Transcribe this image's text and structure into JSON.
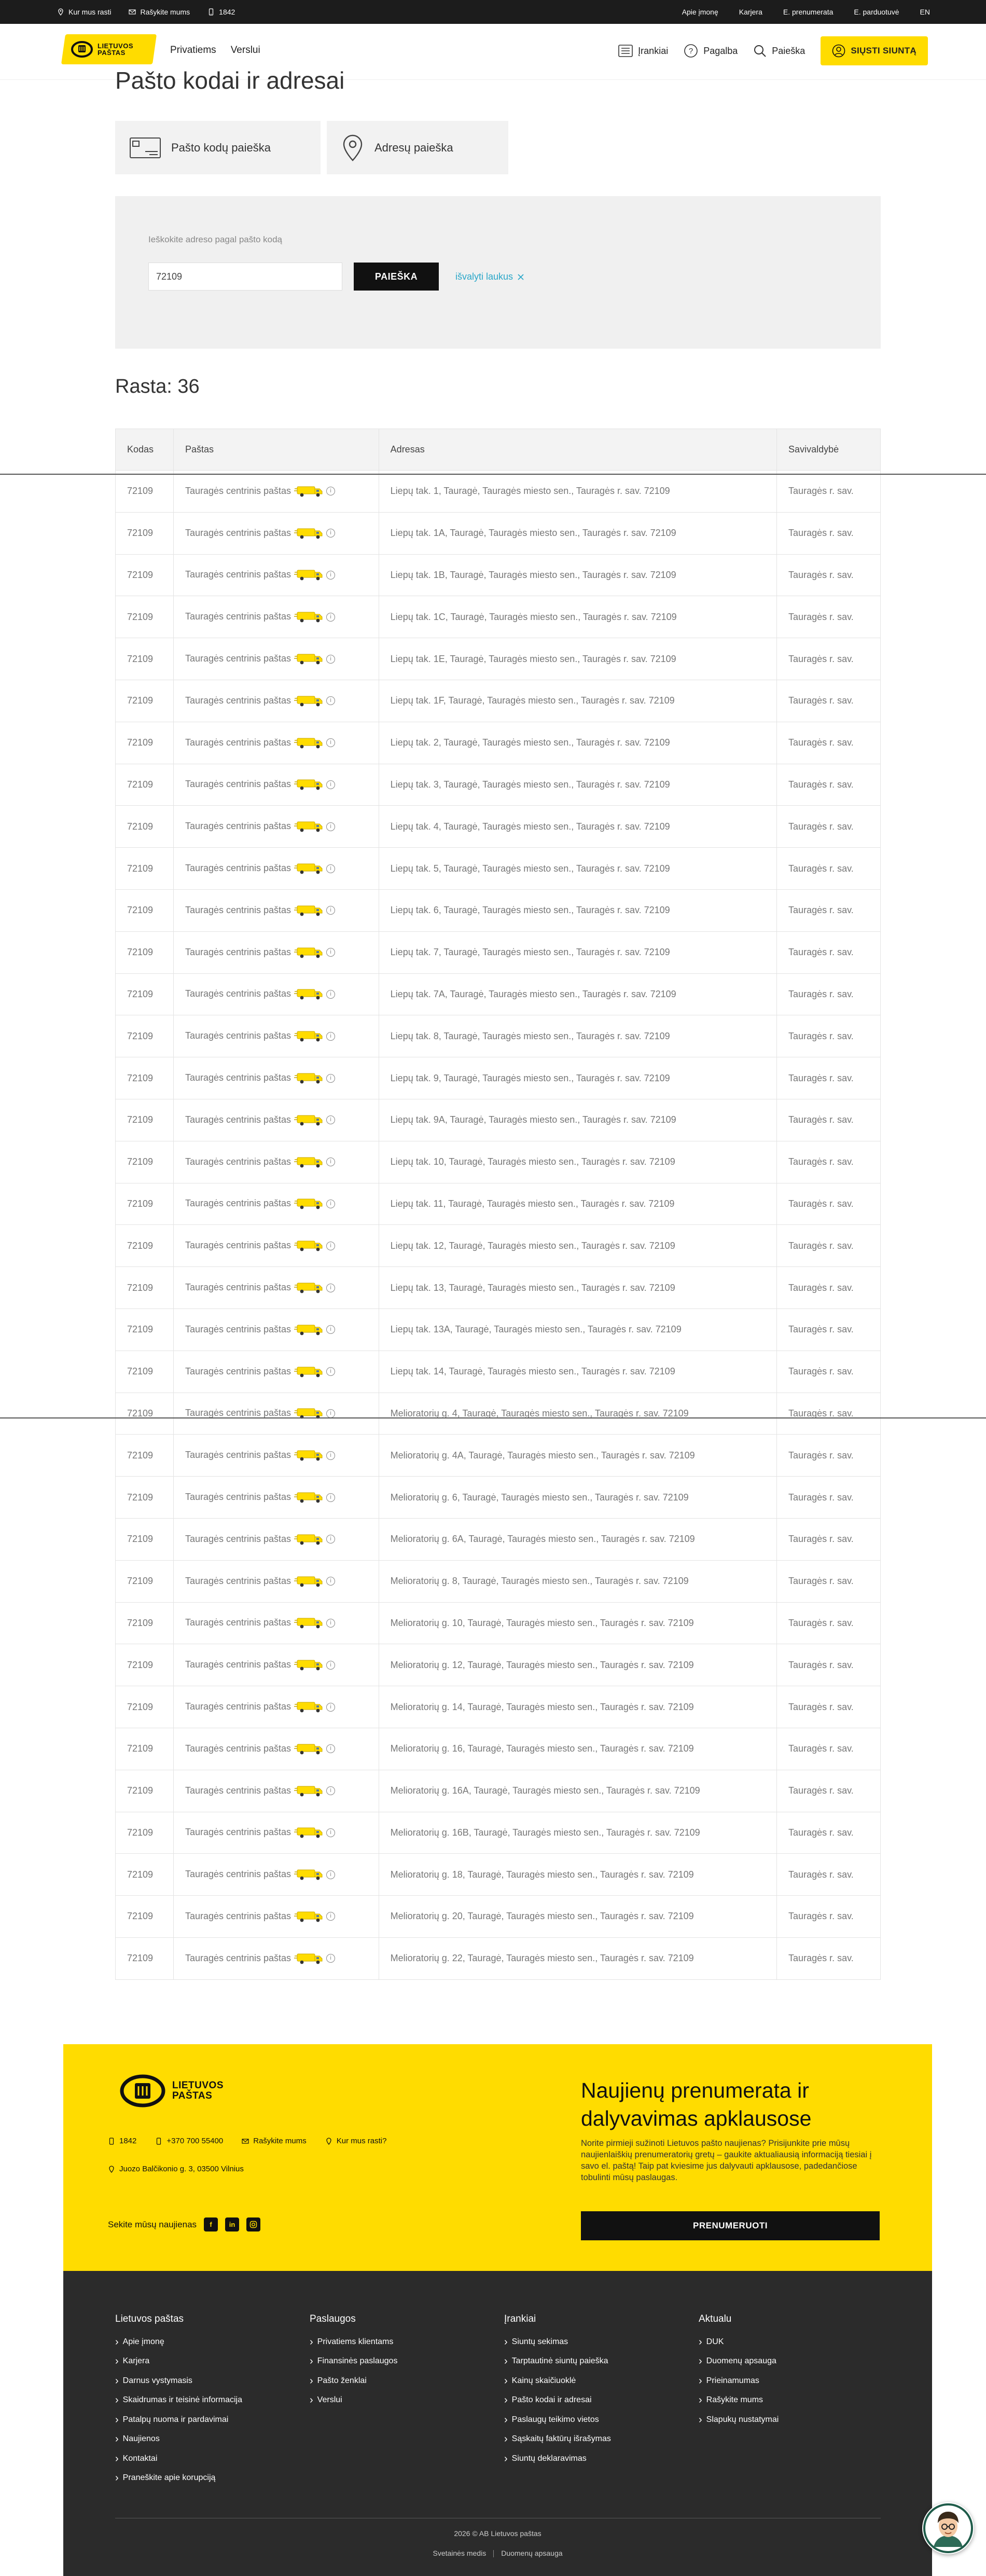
{
  "topbar": {
    "left": [
      {
        "label": "Kur mus rasti",
        "icon": "location-icon"
      },
      {
        "label": "Rašykite mums",
        "icon": "mail-icon"
      },
      {
        "label": "1842",
        "icon": "phone-icon"
      }
    ],
    "right": [
      "Apie įmonę",
      "Karjera",
      "E. prenumerata",
      "E. parduotuvė",
      "EN"
    ]
  },
  "header": {
    "logo_line1": "LIETUVOS",
    "logo_line2": "PAŠTAS",
    "nav": [
      "Privatiems",
      "Verslui"
    ],
    "tools": "Įrankiai",
    "help": "Pagalba",
    "search": "Paieška",
    "send": "SIŲSTI SIUNTĄ"
  },
  "page": {
    "title": "Pašto kodai ir adresai",
    "tab_postcode": "Pašto kodų paieška",
    "tab_address": "Adresų paieška",
    "search_label": "Ieškokite adreso pagal pašto kodą",
    "search_value": "72109",
    "search_button": "PAIEŠKA",
    "clear_label": "išvalyti laukus",
    "results_count": "Rasta: 36"
  },
  "table": {
    "headers": [
      "Kodas",
      "Paštas",
      "Adresas",
      "Savivaldybė"
    ],
    "rows": [
      {
        "code": "72109",
        "office": "Tauragės centrinis paštas",
        "address": "Liepų tak. 1, Tauragė, Tauragės miesto sen., Tauragės r. sav. 72109",
        "municipality": "Tauragės r. sav."
      },
      {
        "code": "72109",
        "office": "Tauragės centrinis paštas",
        "address": "Liepų tak. 1A, Tauragė, Tauragės miesto sen., Tauragės r. sav. 72109",
        "municipality": "Tauragės r. sav."
      },
      {
        "code": "72109",
        "office": "Tauragės centrinis paštas",
        "address": "Liepų tak. 1B, Tauragė, Tauragės miesto sen., Tauragės r. sav. 72109",
        "municipality": "Tauragės r. sav."
      },
      {
        "code": "72109",
        "office": "Tauragės centrinis paštas",
        "address": "Liepų tak. 1C, Tauragė, Tauragės miesto sen., Tauragės r. sav. 72109",
        "municipality": "Tauragės r. sav."
      },
      {
        "code": "72109",
        "office": "Tauragės centrinis paštas",
        "address": "Liepų tak. 1E, Tauragė, Tauragės miesto sen., Tauragės r. sav. 72109",
        "municipality": "Tauragės r. sav."
      },
      {
        "code": "72109",
        "office": "Tauragės centrinis paštas",
        "address": "Liepų tak. 1F, Tauragė, Tauragės miesto sen., Tauragės r. sav. 72109",
        "municipality": "Tauragės r. sav."
      },
      {
        "code": "72109",
        "office": "Tauragės centrinis paštas",
        "address": "Liepų tak. 2, Tauragė, Tauragės miesto sen., Tauragės r. sav. 72109",
        "municipality": "Tauragės r. sav."
      },
      {
        "code": "72109",
        "office": "Tauragės centrinis paštas",
        "address": "Liepų tak. 3, Tauragė, Tauragės miesto sen., Tauragės r. sav. 72109",
        "municipality": "Tauragės r. sav."
      },
      {
        "code": "72109",
        "office": "Tauragės centrinis paštas",
        "address": "Liepų tak. 4, Tauragė, Tauragės miesto sen., Tauragės r. sav. 72109",
        "municipality": "Tauragės r. sav."
      },
      {
        "code": "72109",
        "office": "Tauragės centrinis paštas",
        "address": "Liepų tak. 5, Tauragė, Tauragės miesto sen., Tauragės r. sav. 72109",
        "municipality": "Tauragės r. sav."
      },
      {
        "code": "72109",
        "office": "Tauragės centrinis paštas",
        "address": "Liepų tak. 6, Tauragė, Tauragės miesto sen., Tauragės r. sav. 72109",
        "municipality": "Tauragės r. sav."
      },
      {
        "code": "72109",
        "office": "Tauragės centrinis paštas",
        "address": "Liepų tak. 7, Tauragė, Tauragės miesto sen., Tauragės r. sav. 72109",
        "municipality": "Tauragės r. sav."
      },
      {
        "code": "72109",
        "office": "Tauragės centrinis paštas",
        "address": "Liepų tak. 7A, Tauragė, Tauragės miesto sen., Tauragės r. sav. 72109",
        "municipality": "Tauragės r. sav."
      },
      {
        "code": "72109",
        "office": "Tauragės centrinis paštas",
        "address": "Liepų tak. 8, Tauragė, Tauragės miesto sen., Tauragės r. sav. 72109",
        "municipality": "Tauragės r. sav."
      },
      {
        "code": "72109",
        "office": "Tauragės centrinis paštas",
        "address": "Liepų tak. 9, Tauragė, Tauragės miesto sen., Tauragės r. sav. 72109",
        "municipality": "Tauragės r. sav."
      },
      {
        "code": "72109",
        "office": "Tauragės centrinis paštas",
        "address": "Liepų tak. 9A, Tauragė, Tauragės miesto sen., Tauragės r. sav. 72109",
        "municipality": "Tauragės r. sav."
      },
      {
        "code": "72109",
        "office": "Tauragės centrinis paštas",
        "address": "Liepų tak. 10, Tauragė, Tauragės miesto sen., Tauragės r. sav. 72109",
        "municipality": "Tauragės r. sav."
      },
      {
        "code": "72109",
        "office": "Tauragės centrinis paštas",
        "address": "Liepų tak. 11, Tauragė, Tauragės miesto sen., Tauragės r. sav. 72109",
        "municipality": "Tauragės r. sav."
      },
      {
        "code": "72109",
        "office": "Tauragės centrinis paštas",
        "address": "Liepų tak. 12, Tauragė, Tauragės miesto sen., Tauragės r. sav. 72109",
        "municipality": "Tauragės r. sav."
      },
      {
        "code": "72109",
        "office": "Tauragės centrinis paštas",
        "address": "Liepų tak. 13, Tauragė, Tauragės miesto sen., Tauragės r. sav. 72109",
        "municipality": "Tauragės r. sav."
      },
      {
        "code": "72109",
        "office": "Tauragės centrinis paštas",
        "address": "Liepų tak. 13A, Tauragė, Tauragės miesto sen., Tauragės r. sav. 72109",
        "municipality": "Tauragės r. sav."
      },
      {
        "code": "72109",
        "office": "Tauragės centrinis paštas",
        "address": "Liepų tak. 14, Tauragė, Tauragės miesto sen., Tauragės r. sav. 72109",
        "municipality": "Tauragės r. sav."
      },
      {
        "code": "72109",
        "office": "Tauragės centrinis paštas",
        "address": "Melioratorių g. 4, Tauragė, Tauragės miesto sen., Tauragės r. sav. 72109",
        "municipality": "Tauragės r. sav."
      },
      {
        "code": "72109",
        "office": "Tauragės centrinis paštas",
        "address": "Melioratorių g. 4A, Tauragė, Tauragės miesto sen., Tauragės r. sav. 72109",
        "municipality": "Tauragės r. sav."
      },
      {
        "code": "72109",
        "office": "Tauragės centrinis paštas",
        "address": "Melioratorių g. 6, Tauragė, Tauragės miesto sen., Tauragės r. sav. 72109",
        "municipality": "Tauragės r. sav."
      },
      {
        "code": "72109",
        "office": "Tauragės centrinis paštas",
        "address": "Melioratorių g. 6A, Tauragė, Tauragės miesto sen., Tauragės r. sav. 72109",
        "municipality": "Tauragės r. sav."
      },
      {
        "code": "72109",
        "office": "Tauragės centrinis paštas",
        "address": "Melioratorių g. 8, Tauragė, Tauragės miesto sen., Tauragės r. sav. 72109",
        "municipality": "Tauragės r. sav."
      },
      {
        "code": "72109",
        "office": "Tauragės centrinis paštas",
        "address": "Melioratorių g. 10, Tauragė, Tauragės miesto sen., Tauragės r. sav. 72109",
        "municipality": "Tauragės r. sav."
      },
      {
        "code": "72109",
        "office": "Tauragės centrinis paštas",
        "address": "Melioratorių g. 12, Tauragė, Tauragės miesto sen., Tauragės r. sav. 72109",
        "municipality": "Tauragės r. sav."
      },
      {
        "code": "72109",
        "office": "Tauragės centrinis paštas",
        "address": "Melioratorių g. 14, Tauragė, Tauragės miesto sen., Tauragės r. sav. 72109",
        "municipality": "Tauragės r. sav."
      },
      {
        "code": "72109",
        "office": "Tauragės centrinis paštas",
        "address": "Melioratorių g. 16, Tauragė, Tauragės miesto sen., Tauragės r. sav. 72109",
        "municipality": "Tauragės r. sav."
      },
      {
        "code": "72109",
        "office": "Tauragės centrinis paštas",
        "address": "Melioratorių g. 16A, Tauragė, Tauragės miesto sen., Tauragės r. sav. 72109",
        "municipality": "Tauragės r. sav."
      },
      {
        "code": "72109",
        "office": "Tauragės centrinis paštas",
        "address": "Melioratorių g. 16B, Tauragė, Tauragės miesto sen., Tauragės r. sav. 72109",
        "municipality": "Tauragės r. sav."
      },
      {
        "code": "72109",
        "office": "Tauragės centrinis paštas",
        "address": "Melioratorių g. 18, Tauragė, Tauragės miesto sen., Tauragės r. sav. 72109",
        "municipality": "Tauragės r. sav."
      },
      {
        "code": "72109",
        "office": "Tauragės centrinis paštas",
        "address": "Melioratorių g. 20, Tauragė, Tauragės miesto sen., Tauragės r. sav. 72109",
        "municipality": "Tauragės r. sav."
      },
      {
        "code": "72109",
        "office": "Tauragės centrinis paštas",
        "address": "Melioratorių g. 22, Tauragė, Tauragės miesto sen., Tauragės r. sav. 72109",
        "municipality": "Tauragės r. sav."
      }
    ]
  },
  "footer": {
    "logo_line1": "LIETUVOS",
    "logo_line2": "PAŠTAS",
    "contacts": [
      {
        "label": "1842",
        "icon": "phone-icon"
      },
      {
        "label": "+370 700 55400",
        "icon": "phone-icon"
      },
      {
        "label": "Rašykite mums",
        "icon": "mail-icon"
      },
      {
        "label": "Kur mus rasti?",
        "icon": "location-icon"
      }
    ],
    "address": "Juozo Balčikonio g. 3, 03500 Vilnius",
    "social_label": "Sekite mūsų naujienas",
    "newsletter_title": "Naujienų prenumerata ir dalyvavimas apklausose",
    "newsletter_text": "Norite pirmieji sužinoti Lietuvos pašto naujienas? Prisijunkite prie mūsų naujienlaiškių prenumeratorių gretų – gaukite aktualiausią informaciją tiesiai į savo el. paštą! Taip pat kviesime jus dalyvauti apklausose, padedančiose tobulinti mūsų paslaugas.",
    "newsletter_button": "PRENUMERUOTI",
    "columns": [
      {
        "title": "Lietuvos paštas",
        "items": [
          "Apie įmonę",
          "Karjera",
          "Darnus vystymasis",
          "Skaidrumas ir teisinė informacija",
          "Patalpų nuoma ir pardavimai",
          "Naujienos",
          "Kontaktai",
          "Praneškite apie korupciją"
        ]
      },
      {
        "title": "Paslaugos",
        "items": [
          "Privatiems klientams",
          "Finansinės paslaugos",
          "Pašto ženklai",
          "Verslui"
        ]
      },
      {
        "title": "Įrankiai",
        "items": [
          "Siuntų sekimas",
          "Tarptautinė siuntų paieška",
          "Kainų skaičiuoklė",
          "Pašto kodai ir adresai",
          "Paslaugų teikimo vietos",
          "Sąskaitų faktūrų išrašymas",
          "Siuntų deklaravimas"
        ]
      },
      {
        "title": "Aktualu",
        "items": [
          "DUK",
          "Duomenų apsauga",
          "Prieinamumas",
          "Rašykite mums",
          "Slapukų nustatymai"
        ]
      }
    ],
    "copyright": "2026 © AB Lietuvos paštas",
    "links": [
      "Svetainės medis",
      "Duomenų apsauga"
    ]
  },
  "colors": {
    "brand_yellow": "#ffdc00",
    "dark": "#2b2b2b",
    "accent_link": "#2aa7c9"
  }
}
